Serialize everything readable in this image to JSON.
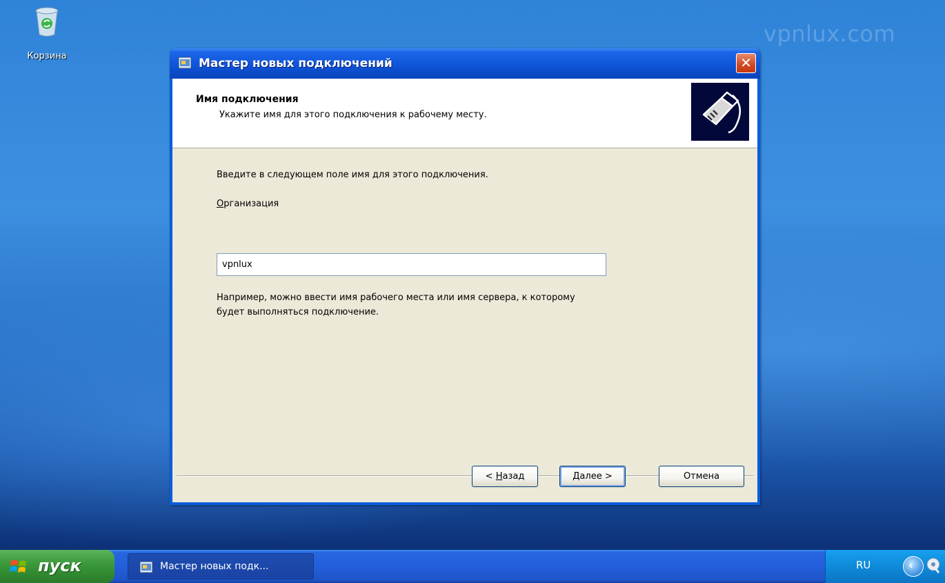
{
  "desktop": {
    "watermark": "vpnlux.com",
    "recycle_bin_label": "Корзина"
  },
  "window": {
    "title": "Мастер новых подключений",
    "close_glyph": "✕",
    "header": {
      "title": "Имя подключения",
      "subtitle": "Укажите имя для этого подключения к рабочему месту."
    },
    "instruction": "Введите в следующем поле имя для этого подключения.",
    "field_label_access_key": "О",
    "field_label_rest": "рганизация",
    "field_value": "vpnlux",
    "hint_line1": "Например, можно ввести имя рабочего места или имя сервера, к которому",
    "hint_line2": "будет выполняться подключение.",
    "buttons": {
      "back_prefix": "< ",
      "back_access_key": "Н",
      "back_rest": "азад",
      "next_access_key": "Д",
      "next_rest": "алее",
      "next_suffix": " >",
      "cancel": "Отмена"
    }
  },
  "taskbar": {
    "start_label": "пуск",
    "task_label": "Мастер новых подк...",
    "language": "RU",
    "tray_glyph": "‹"
  },
  "icons": [
    "recycle-bin-icon",
    "wizard-icon",
    "close-icon",
    "connection-plug-icon",
    "windows-flag-icon",
    "tray-expand-icon",
    "hardware-icon"
  ],
  "colors": {
    "titlebar": "#0a55d8",
    "dialog_face": "#ece9d8",
    "start_button": "#3c9a3c",
    "taskbar": "#245edb",
    "tray": "#0e8ad9",
    "close_button": "#d14a22"
  }
}
